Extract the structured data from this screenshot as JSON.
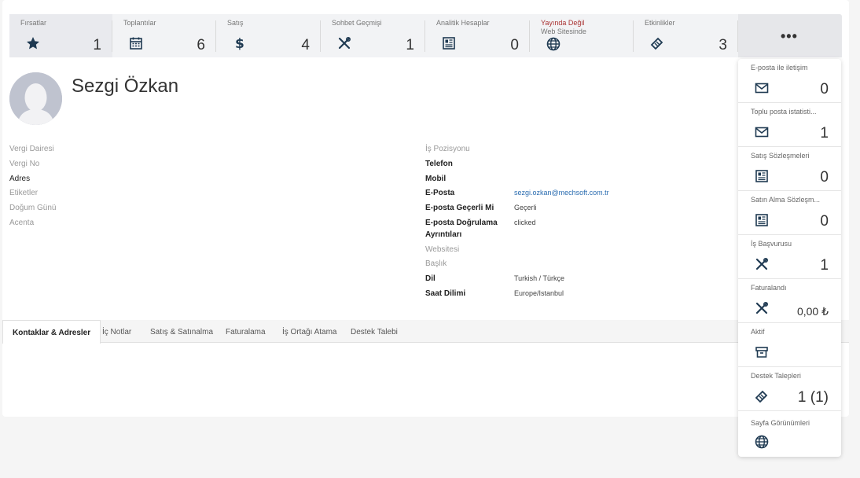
{
  "stats": [
    {
      "label": "Fırsatlar",
      "value": "1",
      "icon": "star-icon"
    },
    {
      "label": "Toplantılar",
      "value": "6",
      "icon": "calendar-icon"
    },
    {
      "label": "Satış",
      "value": "4",
      "icon": "dollar-icon"
    },
    {
      "label": "Sohbet Geçmişi",
      "value": "1",
      "icon": "tools-icon"
    },
    {
      "label": "Analitik Hesaplar",
      "value": "0",
      "icon": "ledger-icon"
    },
    {
      "label": "Yayında Değil",
      "label2": "Web Sitesinde",
      "icon": "globe-icon"
    },
    {
      "label": "Etkinlikler",
      "value": "3",
      "icon": "ticket-icon"
    }
  ],
  "more_label": "•••",
  "partner": {
    "name": "Sezgi Özkan"
  },
  "left_fields": [
    {
      "label": "Vergi Dairesi"
    },
    {
      "label": "Vergi No"
    },
    {
      "label": "Adres"
    },
    {
      "label": "Etiketler"
    },
    {
      "label": "Doğum Günü"
    },
    {
      "label": "Acenta"
    }
  ],
  "right_fields": [
    {
      "label": "İş Pozisyonu",
      "value": ""
    },
    {
      "label": "Telefon",
      "value": ""
    },
    {
      "label": "Mobil",
      "value": ""
    },
    {
      "label": "E-Posta",
      "value": "sezgi.ozkan@mechsoft.com.tr"
    },
    {
      "label": "E-posta Geçerli Mi",
      "value": "Geçerli"
    },
    {
      "label": "E-posta Doğrulama",
      "label2": "Ayrıntıları",
      "value": "clicked"
    },
    {
      "label": "Websitesi",
      "value": ""
    },
    {
      "label": "Başlık",
      "value": ""
    },
    {
      "label": "Dil",
      "value": "Turkish / Türkçe"
    },
    {
      "label": "Saat Dilimi",
      "value": "Europe/Istanbul"
    }
  ],
  "tabs": [
    "Kontaklar & Adresler",
    "İç Notlar",
    "Satış & Satınalma",
    "Faturalama",
    "İş Ortağı Atama",
    "Destek Talebi"
  ],
  "dropdown": [
    {
      "label": "E-posta ile iletişim",
      "value": "0",
      "icon": "envelope-icon"
    },
    {
      "label": "Toplu posta istatisti...",
      "value": "1",
      "icon": "envelope-icon"
    },
    {
      "label": "Satış Sözleşmeleri",
      "value": "0",
      "icon": "ledger-icon"
    },
    {
      "label": "Satın Alma Sözleşm...",
      "value": "0",
      "icon": "ledger-icon"
    },
    {
      "label": "İş Başvurusu",
      "value": "1",
      "icon": "tools-icon"
    },
    {
      "label": "Faturalandı",
      "value": "0,00 ₺",
      "icon": "tools-icon"
    },
    {
      "label": "Aktif",
      "value": "",
      "icon": "archive-icon"
    },
    {
      "label": "Destek Talepleri",
      "value": "1 (1)",
      "icon": "ticket-icon"
    },
    {
      "label": "Sayfa Görünümleri",
      "value": "",
      "icon": "globe-icon"
    }
  ],
  "colors": {
    "accent": "#2a6cb0",
    "icon": "#1f3a52",
    "warning": "#a33"
  }
}
